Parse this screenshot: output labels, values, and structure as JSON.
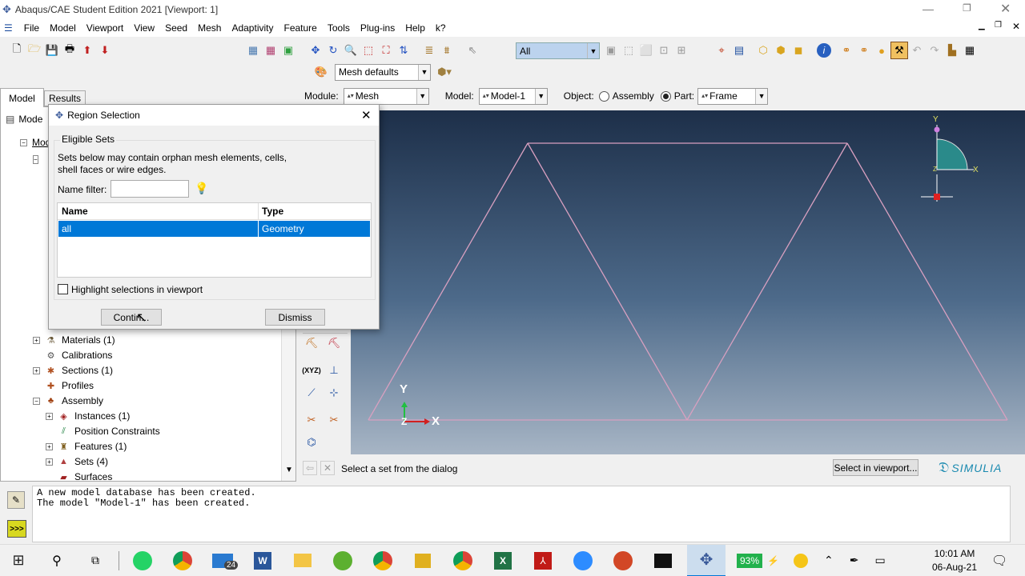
{
  "window": {
    "title": "Abaqus/CAE Student Edition 2021 [Viewport: 1]"
  },
  "menu": [
    "File",
    "Model",
    "Viewport",
    "View",
    "Seed",
    "Mesh",
    "Adaptivity",
    "Feature",
    "Tools",
    "Plug-ins",
    "Help",
    "k?"
  ],
  "toolbar": {
    "selection_filter": "All",
    "mesh_defaults": "Mesh defaults"
  },
  "context": {
    "module_label": "Module:",
    "module_value": "Mesh",
    "model_label": "Model:",
    "model_value": "Model-1",
    "object_label": "Object:",
    "object_assembly": "Assembly",
    "object_part": "Part:",
    "part_value": "Frame"
  },
  "tabs": {
    "model": "Model",
    "results": "Results"
  },
  "tree": {
    "header": "Mode",
    "root": "Mod",
    "items": [
      {
        "label": "Materials (1)",
        "expand": "+",
        "icon": "materials-icon",
        "glyph": "⚗",
        "color": "#6a5a3a"
      },
      {
        "label": "Calibrations",
        "expand": "",
        "icon": "calibrations-icon",
        "glyph": "⚙",
        "color": "#555"
      },
      {
        "label": "Sections (1)",
        "expand": "+",
        "icon": "sections-icon",
        "glyph": "✱",
        "color": "#b05020"
      },
      {
        "label": "Profiles",
        "expand": "",
        "icon": "profiles-icon",
        "glyph": "✚",
        "color": "#b05020"
      },
      {
        "label": "Assembly",
        "expand": "−",
        "icon": "assembly-icon",
        "glyph": "♣",
        "color": "#a04010"
      },
      {
        "label": "Instances (1)",
        "expand": "+",
        "icon": "instances-icon",
        "glyph": "◈",
        "color": "#a02020"
      },
      {
        "label": "Position Constraints",
        "expand": "",
        "icon": "position-constraints-icon",
        "glyph": "⫽",
        "color": "#208040"
      },
      {
        "label": "Features (1)",
        "expand": "+",
        "icon": "features-icon",
        "glyph": "♜",
        "color": "#806020"
      },
      {
        "label": "Sets (4)",
        "expand": "+",
        "icon": "sets-icon",
        "glyph": "▲",
        "color": "#b04040"
      },
      {
        "label": "Surfaces",
        "expand": "",
        "icon": "surfaces-icon",
        "glyph": "▰",
        "color": "#a02020"
      }
    ]
  },
  "dialog": {
    "title": "Region Selection",
    "group": "Eligible Sets",
    "description_line1": "Sets below may contain orphan mesh elements, cells,",
    "description_line2": "shell faces or wire edges.",
    "name_filter_label": "Name filter:",
    "name_filter_value": "",
    "columns": [
      "Name",
      "Type"
    ],
    "rows": [
      {
        "name": "all",
        "type": "Geometry"
      }
    ],
    "highlight_label": "Highlight selections in viewport",
    "continue_label": "Contin...",
    "dismiss_label": "Dismiss"
  },
  "viewport": {
    "triad_x": "X",
    "triad_y": "Y",
    "triad_z": "Z",
    "view_x": "X",
    "view_y": "Y",
    "view_z": "Z"
  },
  "status": {
    "prompt": "Select a set from the dialog",
    "select_in_viewport": "Select in viewport...",
    "brand": "SIMULIA"
  },
  "console": {
    "line1": "A new model database has been created.",
    "line2": "The model \"Model-1\" has been created."
  },
  "taskbar": {
    "battery": "93%",
    "time": "10:01 AM",
    "date": "06-Aug-21",
    "mail_badge": "24"
  },
  "colors": {
    "selection": "#0078d7",
    "viewport_top": "#1d2f49",
    "truss": "#d8a0c0"
  }
}
